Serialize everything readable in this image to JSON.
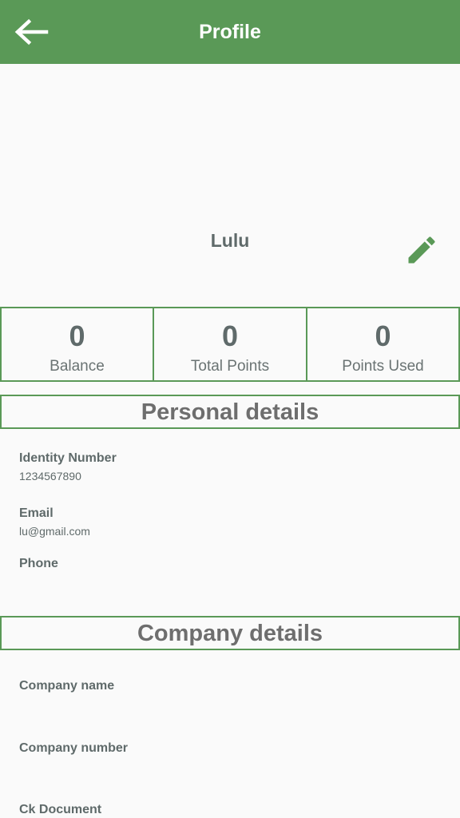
{
  "app_bar": {
    "title": "Profile",
    "background": "#5a9957",
    "back_icon": "arrow-left-icon"
  },
  "profile": {
    "name": "Lulu",
    "edit_icon": "pencil-icon"
  },
  "stats": [
    {
      "value": "0",
      "label": "Balance"
    },
    {
      "value": "0",
      "label": "Total Points"
    },
    {
      "value": "0",
      "label": "Points Used"
    }
  ],
  "personal_details": {
    "title": "Personal details",
    "fields": [
      {
        "label": "Identity Number",
        "value": "1234567890"
      },
      {
        "label": "Email",
        "value": "lu@gmail.com"
      },
      {
        "label": "Phone",
        "value": ""
      }
    ]
  },
  "company_details": {
    "title": "Company details",
    "fields": [
      {
        "label": "Company name",
        "value": ""
      },
      {
        "label": "Company number",
        "value": ""
      },
      {
        "label": "Ck Document",
        "value": ""
      }
    ]
  },
  "colors": {
    "accent": "#5a9957",
    "text": "#5f6a6a",
    "background": "#fafafa"
  }
}
